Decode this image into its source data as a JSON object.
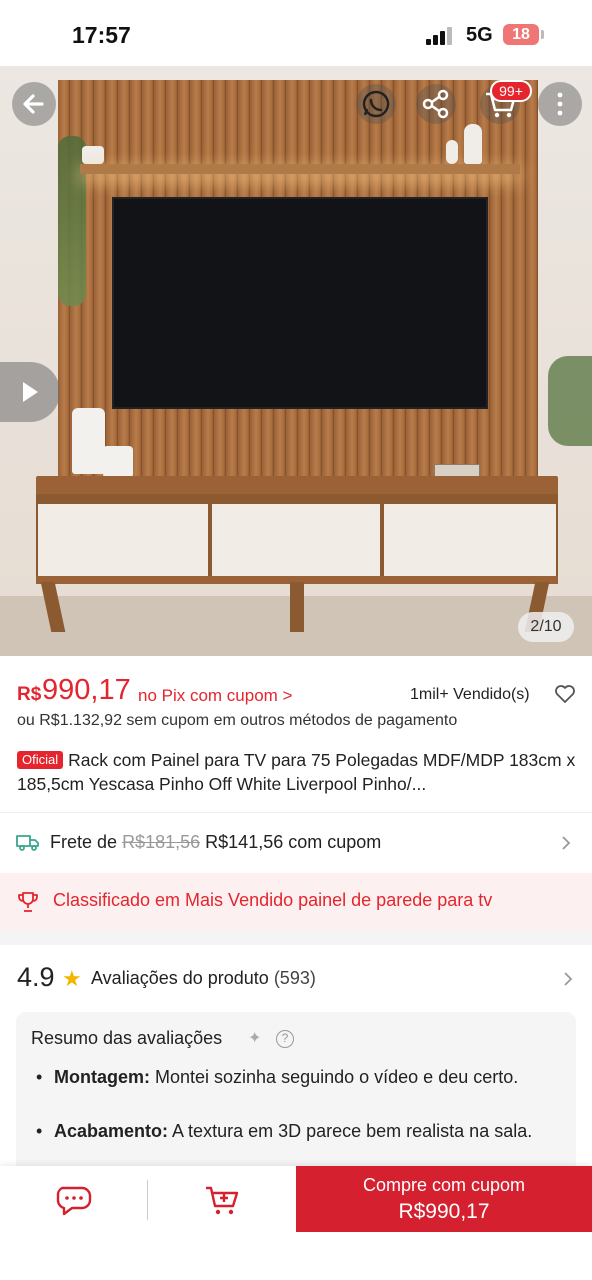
{
  "status_bar": {
    "time": "17:57",
    "network": "5G",
    "battery": "18"
  },
  "hero": {
    "image_counter": "2/10",
    "cart_badge": "99+",
    "icons": [
      "back-arrow-icon",
      "whatsapp-icon",
      "share-icon",
      "cart-icon",
      "more-vertical-icon",
      "play-icon"
    ]
  },
  "price": {
    "currency": "R$",
    "value": "990,17",
    "pix_note": "no Pix com cupom >",
    "sold": "1mil+ Vendido(s)",
    "alt_price": "ou R$1.132,92 sem cupom em outros métodos de pagamento"
  },
  "product": {
    "badge": "Oficial",
    "title": "Rack com Painel para TV para 75 Polegadas MDF/MDP 183cm x 185,5cm Yescasa Pinho Off White Liverpool Pinho/..."
  },
  "shipping": {
    "label": "Frete de",
    "old_price": "R$181,56",
    "new_price": "R$141,56 com cupom"
  },
  "ranking": {
    "text": "Classificado em Mais Vendido painel de parede para tv"
  },
  "reviews": {
    "rating": "4.9",
    "label": "Avaliações do produto",
    "count": "(593)",
    "summary_title": "Resumo das avaliações",
    "help": "?",
    "items": [
      {
        "key": "Montagem:",
        "text": " Montei sozinha seguindo o vídeo e deu certo."
      },
      {
        "key": "Acabamento:",
        "text": " A textura em 3D parece bem realista na sala."
      }
    ]
  },
  "bottom_bar": {
    "buy_line1": "Compre com cupom",
    "buy_line2": "R$990,17"
  },
  "colors": {
    "accent": "#e4252e",
    "buy_button": "#d4202f",
    "star": "#f5b400"
  }
}
